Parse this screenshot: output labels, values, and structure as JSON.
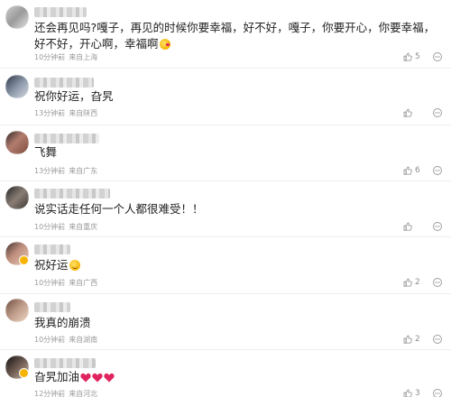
{
  "comments": [
    {
      "text": "还会再见吗?嘎子，再见的时候你要幸福，好不好，嘎子，你要开心，你要幸福，好不好，开心啊，幸福啊",
      "emoji": "kiss-emoji",
      "time": "10分钟前",
      "location": "来自上海",
      "likes": "5"
    },
    {
      "text": "祝你好运，旮旯",
      "time": "13分钟前",
      "location": "来自陕西",
      "likes": ""
    },
    {
      "text": "飞舞",
      "time": "13分钟前",
      "location": "来自广东",
      "likes": "6"
    },
    {
      "text": "说实话走任何一个人都很难受！！",
      "time": "10分钟前",
      "location": "来自重庆",
      "likes": ""
    },
    {
      "text": "祝好运",
      "emoji": "smile-emoji",
      "time": "10分钟前",
      "location": "来自广西",
      "likes": "2"
    },
    {
      "text": "我真的崩溃",
      "time": "10分钟前",
      "location": "来自湖南",
      "likes": "2"
    },
    {
      "text": "旮旯加油",
      "emoji": "three-red-hearts",
      "time": "12分钟前",
      "location": "来自河北",
      "likes": "3"
    }
  ],
  "colors": {
    "meta": "#9a9a9a",
    "heart": "#e0245e",
    "badge": "#f6b400"
  }
}
